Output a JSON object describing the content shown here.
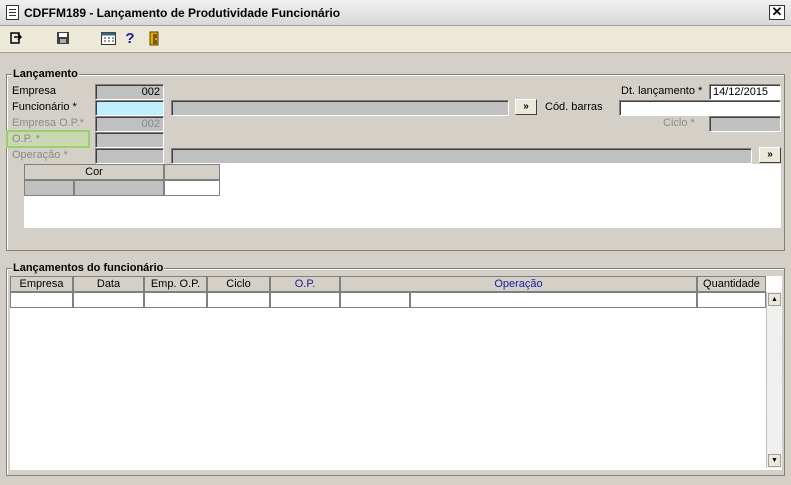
{
  "window": {
    "title": "CDFFM189 - Lançamento de Produtividade Funcionário",
    "close_glyph": "✕"
  },
  "toolbar": {
    "icons": [
      "exit-icon",
      "save-icon",
      "calendar-icon",
      "help-icon",
      "door-icon"
    ],
    "help_glyph": "?"
  },
  "lancamento": {
    "group_title": "Lançamento",
    "empresa_label": "Empresa",
    "empresa_value": "002",
    "funcionario_label": "Funcionário *",
    "funcionario_value": "",
    "funcionario_name": "",
    "lookup_glyph": "»",
    "empresa_op_label": "Empresa O.P.*",
    "empresa_op_value": "002",
    "op_label": "O.P. *",
    "op_value": "",
    "operacao_label": "Operação *",
    "operacao_value": "",
    "operacao_desc": "",
    "dt_label": "Dt. lançamento *",
    "dt_value": "14/12/2015",
    "cod_barras_label": "Cód. barras",
    "cod_barras_value": "",
    "ciclo_label": "Ciclo *",
    "ciclo_value": "",
    "cor_header": "Cor"
  },
  "lancamentos_func": {
    "group_title": "Lançamentos do funcionário",
    "columns": [
      "Empresa",
      "Data",
      "Emp. O.P.",
      "Ciclo",
      "O.P.",
      "Operação",
      "Quantidade"
    ]
  },
  "colors": {
    "accent_blue": "#1a1aa0",
    "highlight_green": "#9ad06a",
    "focus_cyan": "#bfefff"
  }
}
